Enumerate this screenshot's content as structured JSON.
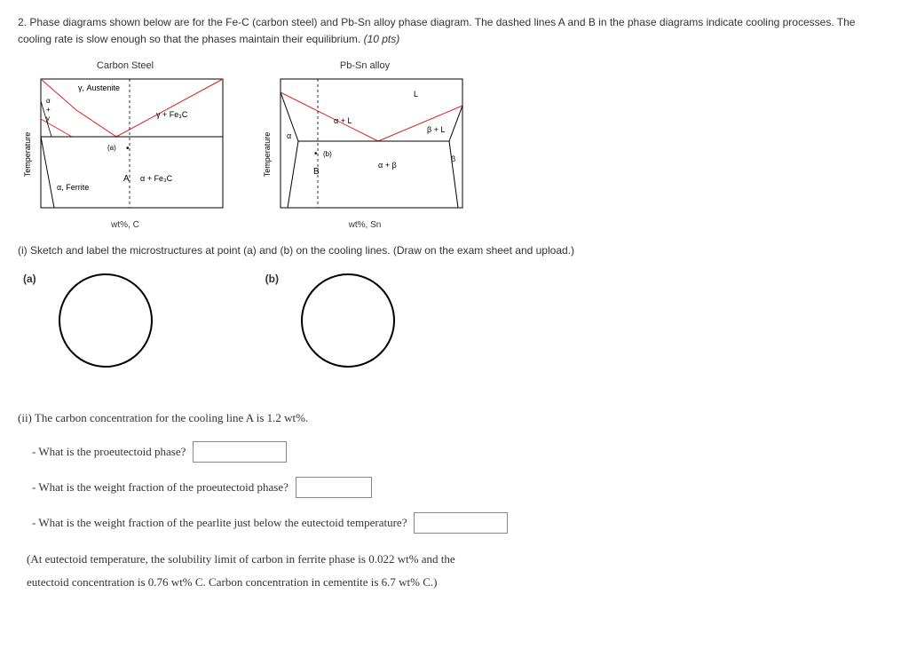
{
  "question": {
    "number_prefix": "2.",
    "text_part1": "Phase diagrams shown below are for the Fe-C (carbon steel) and Pb-Sn alloy phase diagram. The dashed lines A and B in the phase diagrams indicate cooling processes. The cooling rate is slow enough so that the phases maintain their equilibrium.",
    "points": "(10 pts)"
  },
  "diagram1": {
    "title": "Carbon Steel",
    "y_axis": "Temperature",
    "labels": {
      "austenite": "γ, Austenite",
      "alpha_plus_gamma_top": "α",
      "alpha_plus_gamma_mid": "+",
      "alpha_plus_gamma_bot": "γ",
      "gamma_fe3c": "γ + Fe₃C",
      "point_a": "(a)",
      "dot": "•",
      "cooling_A": "A",
      "alpha_fe3c": "α + Fe₃C",
      "ferrite": "α, Ferrite"
    },
    "x_axis": "wt%, C"
  },
  "diagram2": {
    "title": "Pb-Sn alloy",
    "y_axis": "Temperature",
    "labels": {
      "L": "L",
      "alpha_L": "α + L",
      "beta_L": "β + L",
      "alpha": "α",
      "beta": "β",
      "alpha_beta": "α + β",
      "point_b": "(b)",
      "dot": "•",
      "cooling_B": "B"
    },
    "x_axis": "wt%, Sn"
  },
  "subq_i": "(i) Sketch and label the microstructures at point (a) and (b) on the cooling lines. (Draw on the exam sheet and upload.)",
  "sketch_a": "(a)",
  "sketch_b": "(b)",
  "subq_ii_intro": "(ii) The carbon concentration for the cooling line A is 1.2 wt%.",
  "q_proeutectoid_phase": "- What is the proeutectoid phase?",
  "q_weight_fraction_pro": "- What is the weight fraction of the proeutectoid phase?",
  "q_weight_fraction_pearlite": "- What is the weight fraction of the pearlite just below the eutectoid temperature?",
  "context_line1": "(At eutectoid temperature, the solubility limit of carbon in ferrite phase is 0.022 wt% and the",
  "context_line2": "eutectoid concentration is 0.76 wt% C. Carbon concentration in cementite is 6.7 wt% C.)",
  "chart_data": [
    {
      "type": "phase-diagram",
      "system": "Fe-C (Carbon Steel)",
      "x_axis": "wt% C",
      "y_axis": "Temperature",
      "phase_regions": [
        "γ Austenite",
        "α+γ",
        "γ+Fe3C",
        "α Ferrite",
        "α+Fe3C"
      ],
      "eutectoid": {
        "composition_wtC": 0.76,
        "ferrite_solubility_wtC": 0.022,
        "cementite_wtC": 6.7
      },
      "cooling_line_A": {
        "composition_wtC": 1.2,
        "marked_point": "(a) in γ+Fe3C just above eutectoid"
      }
    },
    {
      "type": "phase-diagram",
      "system": "Pb-Sn",
      "x_axis": "wt% Sn",
      "y_axis": "Temperature",
      "phase_regions": [
        "L",
        "α",
        "α+L",
        "β+L",
        "β",
        "α+β"
      ],
      "cooling_line_B": {
        "marked_point": "(b) in α+β just below eutectic",
        "composition_region": "hypoeutectic (near α side)"
      }
    }
  ]
}
